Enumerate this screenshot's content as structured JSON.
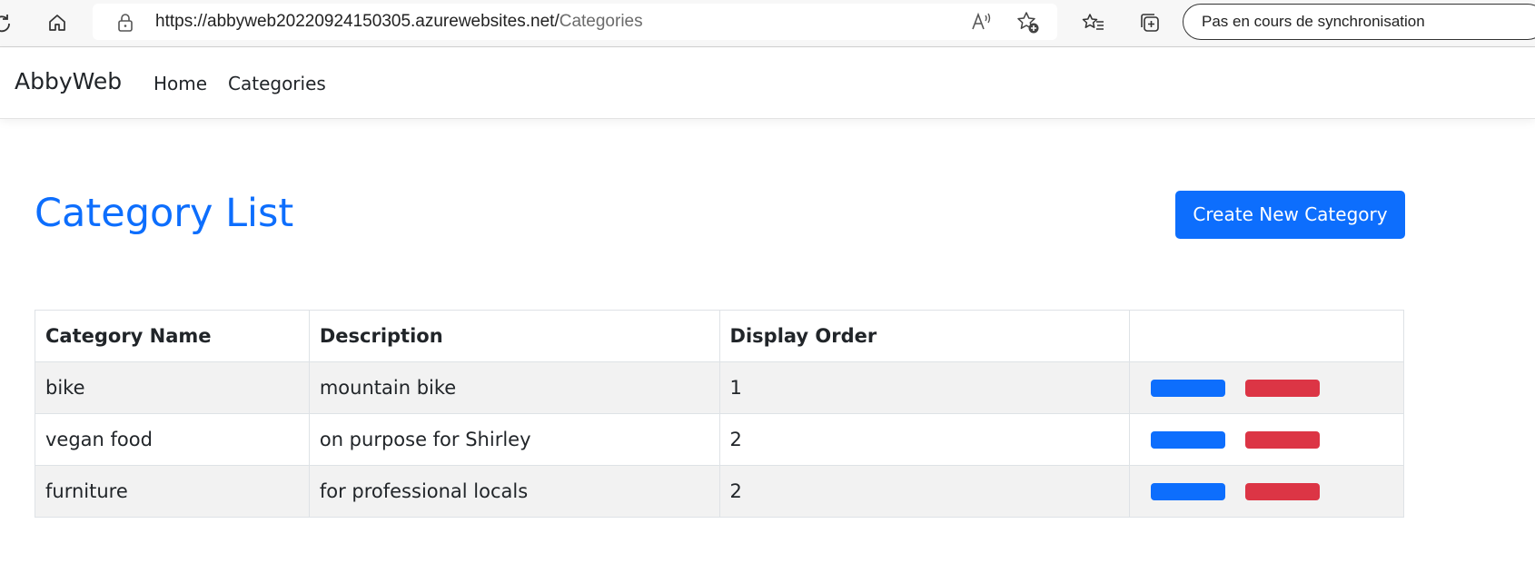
{
  "browser": {
    "url_main": "https://abbyweb20220924150305.azurewebsites.net/",
    "url_path": "Categories",
    "sync_status": "Pas en cours de synchronisation"
  },
  "navbar": {
    "brand": "AbbyWeb",
    "links": [
      "Home",
      "Categories"
    ]
  },
  "page": {
    "title": "Category List",
    "create_button": "Create New Category"
  },
  "table": {
    "headers": [
      "Category Name",
      "Description",
      "Display Order",
      ""
    ],
    "rows": [
      {
        "name": "bike",
        "description": "mountain bike",
        "display_order": "1"
      },
      {
        "name": "vegan food",
        "description": "on purpose for Shirley",
        "display_order": "2"
      },
      {
        "name": "furniture",
        "description": "for professional locals",
        "display_order": "2"
      }
    ]
  },
  "colors": {
    "primary": "#0d6efd",
    "danger": "#dc3545"
  }
}
